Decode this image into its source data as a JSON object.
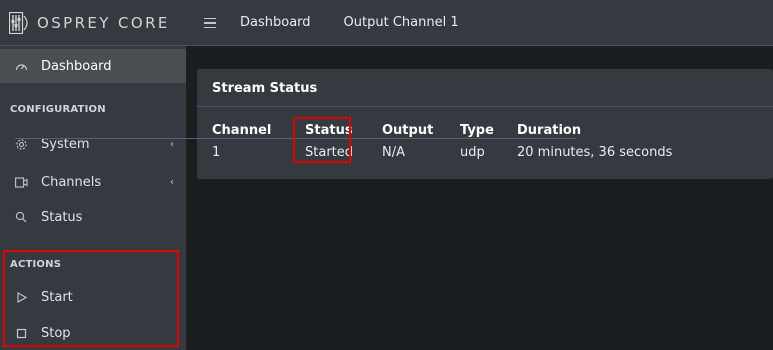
{
  "brand": {
    "name": "OSPREY CORE"
  },
  "topbar": {
    "menu_icon": "hamburger-icon",
    "links": [
      "Dashboard",
      "Output Channel 1"
    ]
  },
  "sidebar": {
    "dashboard": {
      "label": "Dashboard",
      "icon": "tachometer-icon"
    },
    "configuration_header": "CONFIGURATION",
    "system": {
      "label": "System",
      "icon": "gear-icon"
    },
    "channels": {
      "label": "Channels",
      "icon": "channels-icon"
    },
    "status": {
      "label": "Status",
      "icon": "search-icon"
    },
    "actions_header": "ACTIONS",
    "start": {
      "label": "Start",
      "icon": "play-icon"
    },
    "stop": {
      "label": "Stop",
      "icon": "stop-icon"
    }
  },
  "stream_status": {
    "title": "Stream Status",
    "columns": [
      "Channel",
      "Status",
      "Output",
      "Type",
      "Duration"
    ],
    "rows": [
      [
        "1",
        "Started",
        "N/A",
        "udp",
        "20 minutes, 36 seconds"
      ]
    ]
  },
  "colors": {
    "highlight": "#e00000",
    "sidebar_bg": "#343a40",
    "content_bg": "#1b1e21"
  }
}
